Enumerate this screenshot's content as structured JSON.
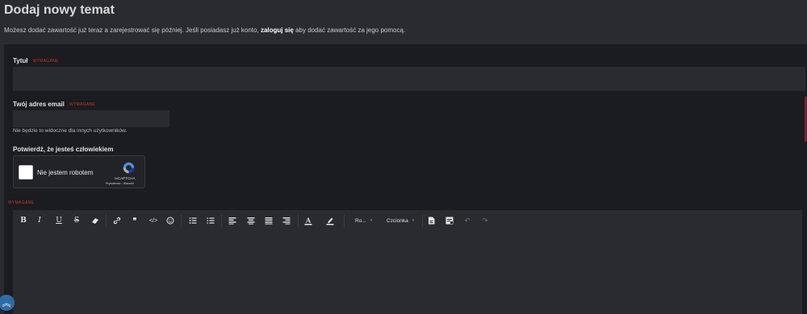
{
  "page": {
    "title": "Dodaj nowy temat",
    "intro_before": "Możesz dodać zawartość już teraz a zarejestrować się później. Jeśli posiadasz już konto, ",
    "intro_link": "zaloguj się",
    "intro_after": " aby dodać zawartość za jego pomocą."
  },
  "form": {
    "title_label": "Tytuł",
    "title_required": "WYMAGANE",
    "title_value": "",
    "email_label": "Twój adres email",
    "email_required": "WYMAGANE",
    "email_value": "",
    "email_hint": "Nie będzie to widoczne dla innych użytkowników.",
    "captcha_label": "Potwierdź, że jesteś człowiekiem",
    "captcha_checkbox": "Nie jestem robotem",
    "captcha_brand": "reCAPTCHA",
    "captcha_links": "Prywatność - Warunki",
    "content_required": "WYMAGANE"
  },
  "editor": {
    "toolbar": {
      "bold": "B",
      "italic": "I",
      "underline": "U",
      "strike": "S",
      "format_dropdown": "Ro...",
      "font_dropdown": "Czcionka"
    },
    "icons": [
      "bold-icon",
      "italic-icon",
      "underline-icon",
      "strikethrough-icon",
      "eraser-icon",
      "link-icon",
      "quote-icon",
      "code-icon",
      "emoji-icon",
      "bullet-list-icon",
      "numbered-list-icon",
      "align-left-icon",
      "align-center-icon",
      "align-justify-icon",
      "align-right-icon",
      "text-color-icon",
      "highlight-icon",
      "document-icon",
      "source-icon",
      "undo-icon",
      "redo-icon"
    ]
  },
  "colors": {
    "background": "#2a2b31",
    "panel": "#1b1c1f",
    "input": "#2a2b2f",
    "required": "#c0392b",
    "scroll_button": "#2e6da4"
  }
}
